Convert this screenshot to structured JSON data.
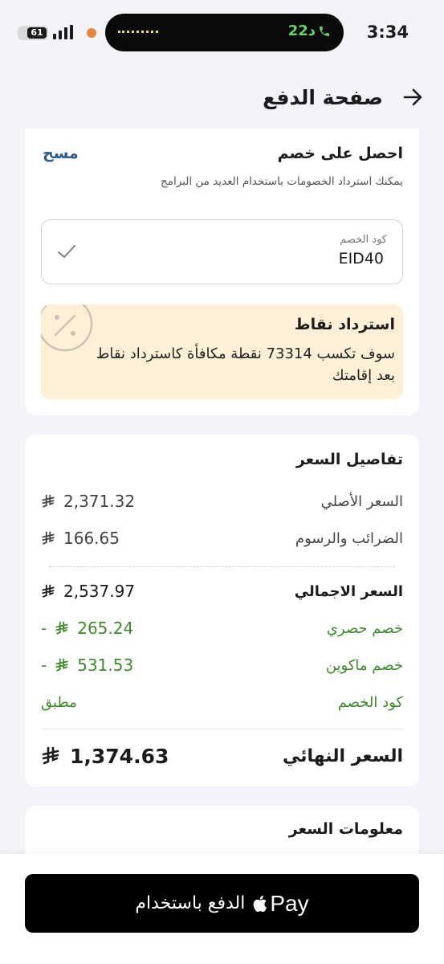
{
  "status_bar": {
    "battery": "61",
    "call_time": "22د",
    "time": "3:34"
  },
  "header": {
    "title": "صفحة الدفع",
    "back_icon": "arrow-right-icon"
  },
  "discount": {
    "title": "احصل على خصم",
    "subtitle": "يمكنك استرداد الخصومات باستخدام العديد من البرامج",
    "clear_label": "مسح",
    "code_label": "كود الخصم",
    "code_value": "EID40",
    "check_icon": "check-icon"
  },
  "points": {
    "title": "استرداد نقاط",
    "body": "سوف تكسب 73314 نقطة مكافأة كاسترداد نقاط بعد إقامتك",
    "icon": "discount-percent-icon"
  },
  "price_details": {
    "title": "تفاصيل السعر",
    "rows": [
      {
        "label": "السعر الأصلي",
        "value": "2,371.32"
      },
      {
        "label": "الضرائب والرسوم",
        "value": "166.65"
      },
      {
        "label": "السعر الاجمالي",
        "value": "2,537.97"
      },
      {
        "label": "خصم حصري",
        "value": "265.24",
        "prefix": "-"
      },
      {
        "label": "خصم ماكوين",
        "value": "531.53",
        "prefix": "-"
      },
      {
        "label": "كود الخصم",
        "value": "مطبق"
      }
    ],
    "final": {
      "label": "السعر النهائي",
      "value": "1,374.63"
    },
    "currency_icon": "riyal-icon"
  },
  "price_info": {
    "title": "معلومات السعر"
  },
  "pay_button": {
    "label": "الدفع باستخدام",
    "logo_text": "Pay"
  },
  "colors": {
    "background": "#f2f4f9",
    "discount_green": "#3d8a2c",
    "link_blue": "#2d5b8c",
    "points_bg": "#fdf0d6"
  }
}
